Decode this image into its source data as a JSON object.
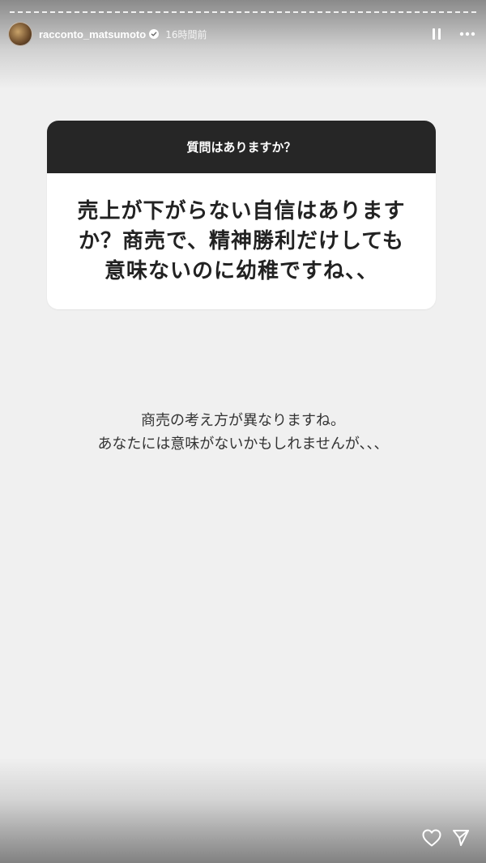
{
  "story": {
    "username": "racconto_matsumoto",
    "time_ago": "16時間前",
    "verified": true
  },
  "question_card": {
    "header": "質問はありますか？",
    "text": "売上が下がらない自信はありますか？商売で、精神勝利だけしても意味ないのに幼稚ですね、、"
  },
  "answer": {
    "lines": [
      "商売の考え方が異なりますね。",
      "あなたには意味がないかもしれませんが、、、"
    ]
  },
  "icons": {
    "verified": "verified-badge-icon",
    "pause": "pause-icon",
    "more": "more-horizontal-icon",
    "like": "heart-icon",
    "share": "paper-plane-icon"
  },
  "colors": {
    "background": "#f0f0f0",
    "card_header": "#262626",
    "card_body": "#ffffff",
    "verified": "#3897f0"
  }
}
